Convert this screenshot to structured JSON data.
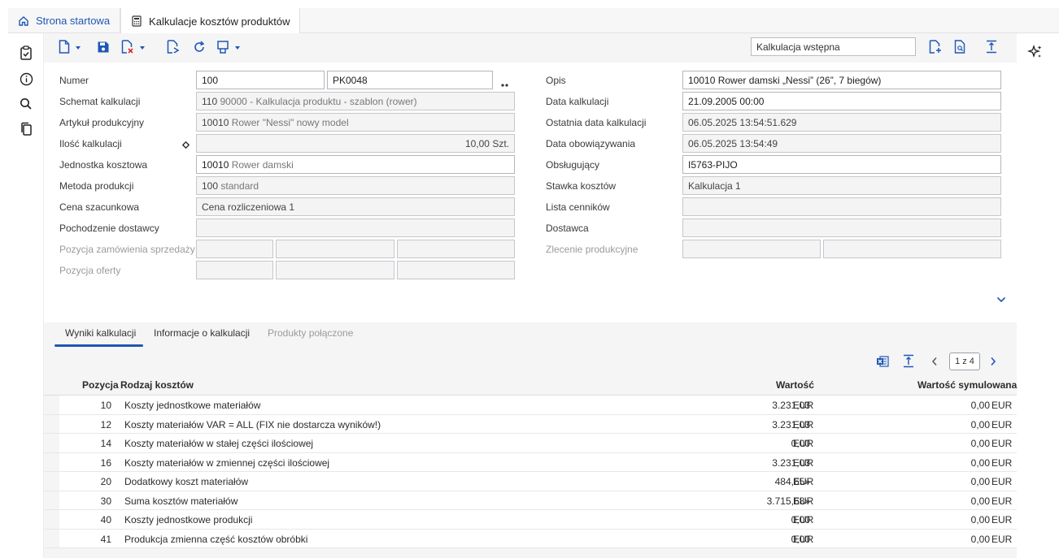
{
  "tabs": {
    "home": "Strona startowa",
    "active": "Kalkulacje kosztów produktów"
  },
  "toolbar": {
    "variant": "Kalkulacja wstępna"
  },
  "form": {
    "left": [
      {
        "label": "Numer",
        "value": "100",
        "value2": "PK0048"
      },
      {
        "label": "Schemat kalkulacji",
        "value": "110",
        "sub": "90000 - Kalkulacja produktu - szablon (rower)"
      },
      {
        "label": "Artykuł produkcyjny",
        "value": "10010",
        "sub": "Rower \"Nessi\" nowy model"
      },
      {
        "label": "Ilość kalkulacji",
        "value": "10,00 Szt."
      },
      {
        "label": "Jednostka kosztowa",
        "value": "10010",
        "sub": "Rower damski"
      },
      {
        "label": "Metoda produkcji",
        "value": "100",
        "sub": "standard"
      },
      {
        "label": "Cena szacunkowa",
        "value": "Cena rozliczeniowa 1"
      },
      {
        "label": "Pochodzenie dostawcy",
        "value": ""
      },
      {
        "label": "Pozycja zamówienia sprzedaży",
        "value": ""
      },
      {
        "label": "Pozycja oferty",
        "value": ""
      }
    ],
    "right": [
      {
        "label": "Opis",
        "value": "10010 Rower damski „Nessi” (26”, 7 biegów)"
      },
      {
        "label": "Data kalkulacji",
        "value": "21.09.2005  00:00"
      },
      {
        "label": "Ostatnia data kalkulacji",
        "value": "06.05.2025  13:54:51.629"
      },
      {
        "label": "Data obowiązywania",
        "value": "06.05.2025  13:54:49"
      },
      {
        "label": "Obsługujący",
        "value": "I5763-PIJO"
      },
      {
        "label": "Stawka kosztów",
        "value": "Kalkulacja 1"
      },
      {
        "label": "Lista cenników",
        "value": ""
      },
      {
        "label": "Dostawca",
        "value": ""
      },
      {
        "label": "Zlecenie produkcyjne",
        "value": ""
      }
    ]
  },
  "subtabs": [
    "Wyniki kalkulacji",
    "Informacje o kalkulacji",
    "Produkty połączone"
  ],
  "pager": "1 z 4",
  "grid": {
    "headers": [
      "Pozycja",
      "Rodzaj kosztów",
      "Wartość",
      "Wartość symulowana"
    ],
    "rows": [
      {
        "pos": "10",
        "type": "Koszty jednostkowe materiałów",
        "value": "3.231,03",
        "cur": "EUR",
        "sim": "0,00",
        "simcur": "EUR"
      },
      {
        "pos": "12",
        "type": "Koszty materiałów VAR = ALL (FIX nie dostarcza wyników!)",
        "value": "3.231,03",
        "cur": "EUR",
        "sim": "0,00",
        "simcur": "EUR"
      },
      {
        "pos": "14",
        "type": "Koszty materiałów w stałej części ilościowej",
        "value": "0,00",
        "cur": "EUR",
        "sim": "0,00",
        "simcur": "EUR"
      },
      {
        "pos": "16",
        "type": "Koszty materiałów w zmiennej części ilościowej",
        "value": "3.231,03",
        "cur": "EUR",
        "sim": "0,00",
        "simcur": "EUR"
      },
      {
        "pos": "20",
        "type": "Dodatkowy koszt materiałów",
        "value": "484,65»",
        "cur": "EUR",
        "sim": "0,00",
        "simcur": "EUR"
      },
      {
        "pos": "30",
        "type": "Suma kosztów materiałów",
        "value": "3.715,68»",
        "cur": "EUR",
        "sim": "0,00",
        "simcur": "EUR"
      },
      {
        "pos": "40",
        "type": "Koszty jednostkowe produkcji",
        "value": "0,00",
        "cur": "EUR",
        "sim": "0,00",
        "simcur": "EUR"
      },
      {
        "pos": "41",
        "type": "Produkcja zmienna część kosztów obróbki",
        "value": "0,00",
        "cur": "EUR",
        "sim": "0,00",
        "simcur": "EUR"
      }
    ]
  },
  "colors": {
    "accent": "#1f57b5",
    "panel": "#f5f5f6"
  },
  "icons": [
    "home-icon",
    "calculator-icon",
    "clipboard-icon",
    "info-icon",
    "search-icon",
    "copy-icon",
    "new-icon",
    "save-icon",
    "delete-icon",
    "duplicate-icon",
    "refresh-icon",
    "print-icon",
    "add-document-icon",
    "preview-icon",
    "fit-height-icon",
    "ai-sparkle-icon",
    "excel-icon",
    "chevron-down-icon",
    "chevron-left-icon",
    "chevron-right-icon"
  ]
}
